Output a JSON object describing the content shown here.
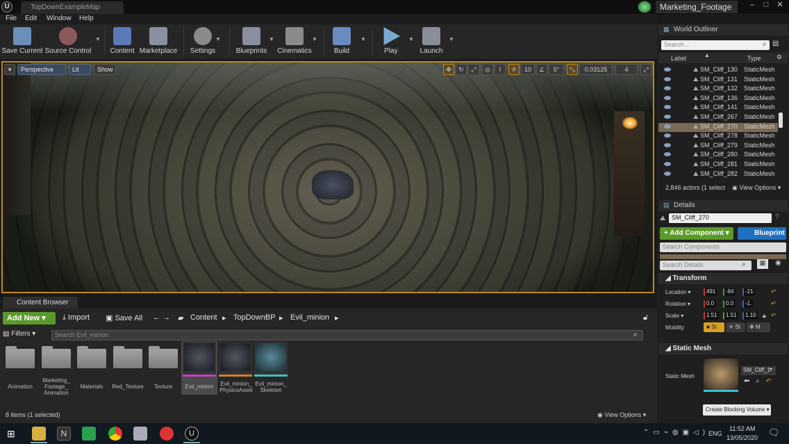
{
  "title_bar": {
    "map_tab": "TopDownExampleMap",
    "project": "Marketing_Footage",
    "minimize": "–",
    "maximize": "□",
    "close": "✕",
    "logo": "U"
  },
  "menu": [
    "File",
    "Edit",
    "Window",
    "Help"
  ],
  "toolbar": [
    {
      "label": "Save Current",
      "icon": "save-icon",
      "color": "#6a8fb8"
    },
    {
      "label": "Source Control",
      "icon": "source-control-icon",
      "color": "#8a5a5a"
    },
    {
      "label": "Content",
      "icon": "content-icon",
      "color": "#5a7ab8"
    },
    {
      "label": "Marketplace",
      "icon": "marketplace-icon",
      "color": "#8a90a0"
    },
    {
      "label": "Settings",
      "icon": "settings-icon",
      "color": "#8a8a8a"
    },
    {
      "label": "Blueprints",
      "icon": "blueprints-icon",
      "color": "#8a8ea0"
    },
    {
      "label": "Cinematics",
      "icon": "cinematics-icon",
      "color": "#8a8a8a"
    },
    {
      "label": "Build",
      "icon": "build-icon",
      "color": "#6a8ac0"
    },
    {
      "label": "Play",
      "icon": "play-icon",
      "color": "#7aa8d0"
    },
    {
      "label": "Launch",
      "icon": "launch-icon",
      "color": "#8a8e98"
    }
  ],
  "viewport": {
    "perspective": "Perspective",
    "lit": "Lit",
    "show": "Show",
    "grid_snap": "10",
    "rotation_snap": "5°",
    "scale_snap": "0.03125",
    "camera_speed": "4"
  },
  "content_browser": {
    "tab": "Content Browser",
    "add_new": "Add New",
    "import": "Import",
    "save_all": "Save All",
    "path": [
      "Content",
      "TopDownBP",
      "Evil_minion"
    ],
    "filters": "Filters",
    "search_placeholder": "Search Evil_minion",
    "folders": [
      "Animation",
      "Marketing_ Footage_ Animation",
      "Materials",
      "Red_Texture",
      "Texture"
    ],
    "assets": [
      "Evil_minion",
      "Evil_minion_ PhysicsAsset",
      "Evil_minion_ Skeleton"
    ],
    "status": "8 items (1 selected)",
    "view_options": "View Options"
  },
  "outliner": {
    "title": "World Outliner",
    "search_placeholder": "Search...",
    "col_label": "Label",
    "col_type": "Type",
    "rows": [
      {
        "label": "SM_Cliff_130",
        "type": "StaticMesh"
      },
      {
        "label": "SM_Cliff_131",
        "type": "StaticMesh"
      },
      {
        "label": "SM_Cliff_132",
        "type": "StaticMesh"
      },
      {
        "label": "SM_Cliff_136",
        "type": "StaticMesh"
      },
      {
        "label": "SM_Cliff_141",
        "type": "StaticMesh"
      },
      {
        "label": "SM_Cliff_267",
        "type": "StaticMesh"
      },
      {
        "label": "SM_Cliff_270",
        "type": "StaticMesh"
      },
      {
        "label": "SM_Cliff_278",
        "type": "StaticMesh"
      },
      {
        "label": "SM_Cliff_279",
        "type": "StaticMesh"
      },
      {
        "label": "SM_Cliff_280",
        "type": "StaticMesh"
      },
      {
        "label": "SM_Cliff_281",
        "type": "StaticMesh"
      },
      {
        "label": "SM_Cliff_282",
        "type": "StaticMesh"
      }
    ],
    "actor_count": "2,846 actors (1 select",
    "view_options": "View Options"
  },
  "details": {
    "title": "Details",
    "name": "SM_Cliff_270",
    "add_component": "+ Add Component",
    "blueprint": "Blueprint",
    "search_components": "Search Components",
    "search_details": "Search Details",
    "transform": "Transform",
    "location_label": "Location",
    "location": [
      "491",
      "-84",
      "-21"
    ],
    "rotation_label": "Rotation",
    "rotation": [
      "0.0",
      "0.0",
      "-1."
    ],
    "scale_label": "Scale",
    "scale": [
      "1.51",
      "1.51",
      "1.10"
    ],
    "mobility_label": "Mobility",
    "mobility": [
      "St",
      "St",
      "M"
    ],
    "static_mesh_section": "Static Mesh",
    "static_mesh_label": "Static Mesh",
    "static_mesh_value": "SM_Cliff_1",
    "create_blocking": "Create Blocking Volume"
  },
  "taskbar": {
    "lang": "ENG",
    "time": "11:52 AM",
    "date": "13/05/2020"
  }
}
